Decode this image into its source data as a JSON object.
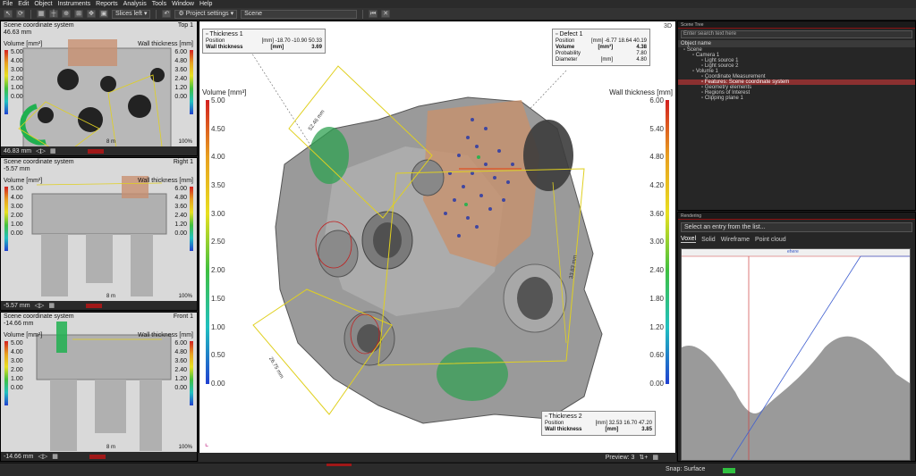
{
  "menu": [
    "File",
    "Edit",
    "Object",
    "Instruments",
    "Reports",
    "Analysis",
    "Tools",
    "Window",
    "Help"
  ],
  "toolbar": {
    "slices_combo": "Slices left",
    "project_settings": "Project settings",
    "scene_combo": "Scene"
  },
  "slice_views": [
    {
      "title": "Scene coordinate system",
      "value": "46.63 mm",
      "view_label": "Top 1",
      "footer_value": "46.83 mm",
      "scale_label_left": "Volume [mm³]",
      "scale_label_right": "Wall thickness [mm]",
      "volume_ticks": [
        "5.00",
        "4.00",
        "3.00",
        "2.00",
        "1.00",
        "0.00"
      ],
      "wall_ticks": [
        "6.00",
        "4.80",
        "3.60",
        "2.40",
        "1.20",
        "0.00"
      ],
      "percent": "100%",
      "scale_note": "8 m"
    },
    {
      "title": "Scene coordinate system",
      "value": "-5.57 mm",
      "view_label": "Right 1",
      "footer_value": "-5.57 mm",
      "scale_label_left": "Volume [mm³]",
      "scale_label_right": "Wall thickness [mm]",
      "volume_ticks": [
        "5.00",
        "4.00",
        "3.00",
        "2.00",
        "1.00",
        "0.00"
      ],
      "wall_ticks": [
        "6.00",
        "4.80",
        "3.60",
        "2.40",
        "1.20",
        "0.00"
      ],
      "percent": "100%",
      "scale_note": "8 m"
    },
    {
      "title": "Scene coordinate system",
      "value": "-14.66 mm",
      "view_label": "Front 1",
      "footer_value": "-14.66 mm",
      "scale_label_left": "Volume [mm³]",
      "scale_label_right": "Wall thickness [mm]",
      "volume_ticks": [
        "5.00",
        "4.00",
        "3.00",
        "2.00",
        "1.00",
        "0.00"
      ],
      "wall_ticks": [
        "6.00",
        "4.80",
        "3.60",
        "2.40",
        "1.20",
        "0.00"
      ],
      "percent": "100%",
      "scale_note": "8 m"
    }
  ],
  "main_view": {
    "left_legend": "Volume [mm³]",
    "right_legend": "Wall thickness [mm]",
    "volume_ticks": [
      "5.00",
      "4.50",
      "4.00",
      "3.50",
      "3.00",
      "2.50",
      "2.00",
      "1.50",
      "1.00",
      "0.50",
      "0.00"
    ],
    "wall_ticks": [
      "6.00",
      "5.40",
      "4.80",
      "4.20",
      "3.60",
      "3.00",
      "2.40",
      "1.80",
      "1.20",
      "0.60",
      "0.00"
    ],
    "corner_label": "3D",
    "preview_label": "Preview: 3",
    "dim_labels": [
      "52.46 mm",
      "33.83 mm",
      "26.75 mm"
    ],
    "thickness1": {
      "title": "Thickness 1",
      "pos_label": "Position",
      "pos_unit": "[mm]",
      "pos_value": "-18.70 -10.90 50.33",
      "wall_label": "Wall thickness",
      "wall_unit": "[mm]",
      "wall_value": "3.69"
    },
    "defect1": {
      "title": "Defect 1",
      "pos_label": "Position",
      "pos_unit": "[mm]",
      "pos_value": "-6.77 18.64 40.19",
      "vol_label": "Volume",
      "vol_unit": "[mm³]",
      "vol_value": "4.38",
      "prob_label": "Probability",
      "prob_value": "7.80",
      "diam_label": "Diameter",
      "diam_unit": "[mm]",
      "diam_value": "4.80"
    },
    "thickness2": {
      "title": "Thickness 2",
      "pos_label": "Position",
      "pos_unit": "[mm]",
      "pos_value": "32.53 16.70 47.20",
      "wall_label": "Wall thickness",
      "wall_unit": "[mm]",
      "wall_value": "3.85"
    }
  },
  "scene_tree": {
    "title": "Scene Tree",
    "search_placeholder": "Enter search text here",
    "column": "Object name",
    "items": [
      {
        "label": "Scene",
        "level": 0
      },
      {
        "label": "Camera 1",
        "level": 1
      },
      {
        "label": "Light source 1",
        "level": 2
      },
      {
        "label": "Light source 2",
        "level": 2
      },
      {
        "label": "Volume 1",
        "level": 1
      },
      {
        "label": "Coordinate Measurement",
        "level": 2
      },
      {
        "label": "Features: Scene coordinate system",
        "level": 2
      },
      {
        "label": "Geometry elements",
        "level": 2
      },
      {
        "label": "Regions of Interest",
        "level": 2
      },
      {
        "label": "Clipping plane 1",
        "level": 2
      }
    ],
    "selected_index": 6
  },
  "rendering": {
    "title": "Rendering",
    "entry_placeholder": "Select an entry from the list...",
    "tabs": [
      "Voxel",
      "Solid",
      "Wireframe",
      "Point cloud"
    ],
    "active_tab": 0,
    "histogram_label": "ehere"
  },
  "status": {
    "snap": "Snap: Surface"
  }
}
